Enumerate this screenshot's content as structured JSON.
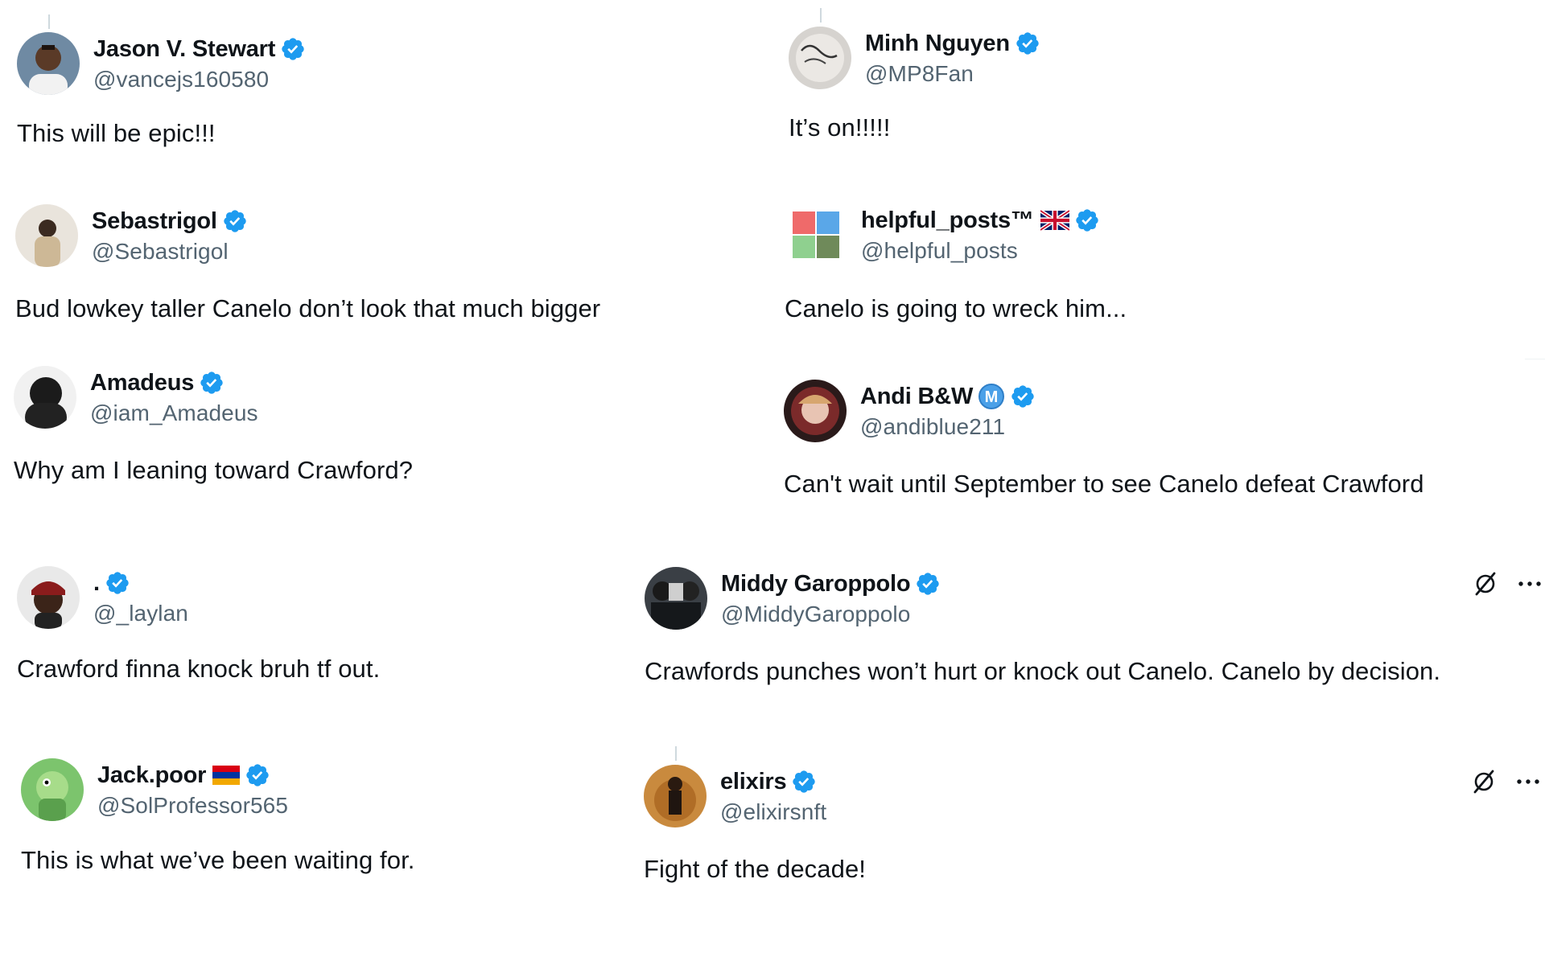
{
  "posts": [
    {
      "name": "Jason V. Stewart",
      "handle": "@vancejs160580",
      "text": "This will be epic!!!"
    },
    {
      "name": "Minh Nguyen",
      "handle": "@MP8Fan",
      "text": "It’s on!!!!!"
    },
    {
      "name": "Sebastrigol",
      "handle": "@Sebastrigol",
      "text": "Bud lowkey taller Canelo don’t  look that much bigger"
    },
    {
      "name": "helpful_posts™",
      "handle": "@helpful_posts",
      "text": "Canelo is going to wreck him..."
    },
    {
      "name": "Amadeus",
      "handle": "@iam_Amadeus",
      "text": "Why am I leaning toward Crawford?"
    },
    {
      "name": "Andi B&W",
      "handle": "@andiblue211",
      "text": "Can't wait until September to see Canelo defeat Crawford"
    },
    {
      "name": ".",
      "handle": "@_laylan",
      "text": "Crawford finna knock bruh tf out."
    },
    {
      "name": "Middy Garoppolo",
      "handle": "@MiddyGaroppolo",
      "text": "Crawfords punches won’t hurt or knock out Canelo. Canelo by decision."
    },
    {
      "name": "Jack.poor",
      "handle": "@SolProfessor565",
      "text": "This is what we’ve been waiting for."
    },
    {
      "name": "elixirs",
      "handle": "@elixirsnft",
      "text": "Fight of the decade!"
    }
  ],
  "badges": {
    "andi_badge_letter": "M"
  },
  "colors": {
    "verified": "#1d9bf0",
    "handle": "#536471",
    "text": "#0f1419"
  },
  "icons": {
    "verified": "verified-badge-icon",
    "grok": "grok-icon",
    "more": "more-options-icon"
  }
}
